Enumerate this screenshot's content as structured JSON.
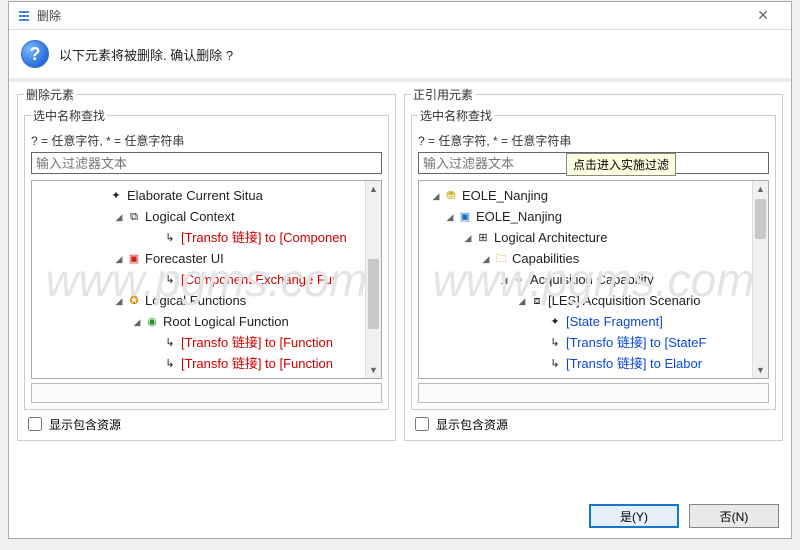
{
  "dialog": {
    "title": "删除",
    "prompt": "以下元素将被删除. 确认删除 ?"
  },
  "left": {
    "group": "删除元素",
    "inner": "选中名称查找",
    "hint1": "? = 任意字符, * = 任意字符串",
    "filter_ph": "输入过滤器文本",
    "rows": {
      "r0": "Elaborate Current Situa",
      "r1": "Logical Context",
      "r2": "[Transfo 链接] to [Componen",
      "r3": "Forecaster UI",
      "r4": "[Component Exchange Fur",
      "r5": "Logical Functions",
      "r6": "Root Logical Function",
      "r7": "[Transfo 链接] to [Function",
      "r8": "[Transfo 链接] to [Function"
    },
    "checkbox": "显示包含资源"
  },
  "right": {
    "group": "正引用元素",
    "inner": "选中名称查找",
    "hint1": "? = 任意字符, * = 任意字符串",
    "filter_ph": "输入过滤器文本",
    "tooltip": "点击进入实施过滤",
    "rows": {
      "r0": "EOLE_Nanjing",
      "r1": "EOLE_Nanjing",
      "r2": "Logical Architecture",
      "r3": "Capabilities",
      "r4": "Acquisition Capability",
      "r5": "[LES] Acquisition Scenario",
      "r6": "[State Fragment]",
      "r7": "[Transfo 链接] to [StateF",
      "r8": "[Transfo 链接] to Elabor"
    },
    "checkbox": "显示包含资源"
  },
  "buttons": {
    "yes": "是(Y)",
    "no": "否(N)"
  },
  "watermark": "www.pgms.com"
}
